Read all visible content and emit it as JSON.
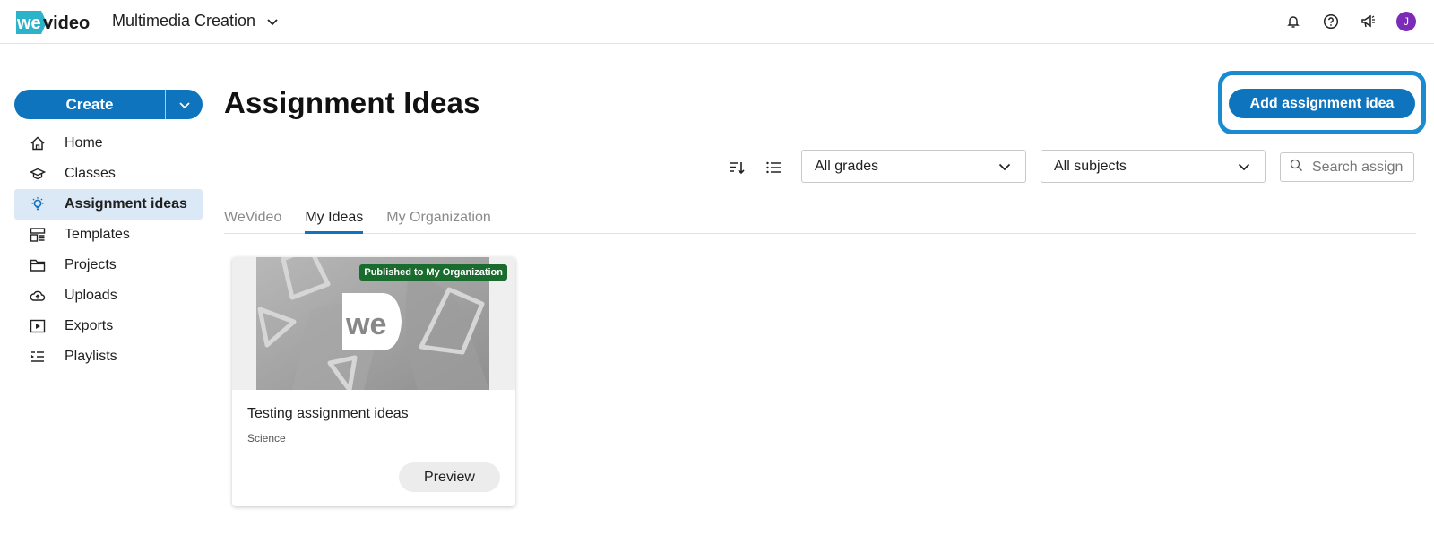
{
  "header": {
    "logo_text": "wevideo",
    "workspace": "Multimedia Creation",
    "icons": [
      "bell-icon",
      "help-icon",
      "megaphone-icon"
    ],
    "avatar_initial": "J",
    "avatar_color": "#7b2bb8"
  },
  "sidebar": {
    "create_label": "Create",
    "items": [
      {
        "label": "Home",
        "icon": "home-icon"
      },
      {
        "label": "Classes",
        "icon": "classes-icon"
      },
      {
        "label": "Assignment ideas",
        "icon": "lightbulb-icon",
        "active": true
      },
      {
        "label": "Templates",
        "icon": "templates-icon"
      },
      {
        "label": "Projects",
        "icon": "folder-icon"
      },
      {
        "label": "Uploads",
        "icon": "cloud-upload-icon"
      },
      {
        "label": "Exports",
        "icon": "export-play-icon"
      },
      {
        "label": "Playlists",
        "icon": "playlist-icon"
      }
    ]
  },
  "main": {
    "title": "Assignment Ideas",
    "add_button": "Add assignment idea",
    "filters": {
      "grades": "All grades",
      "subjects": "All subjects",
      "search_placeholder": "Search assign"
    },
    "tabs": [
      {
        "label": "WeVideo",
        "active": false
      },
      {
        "label": "My Ideas",
        "active": true
      },
      {
        "label": "My Organization",
        "active": false
      }
    ],
    "cards": [
      {
        "badge": "Published to My Organization",
        "title": "Testing assignment ideas",
        "subject": "Science",
        "button": "Preview"
      }
    ]
  },
  "colors": {
    "accent": "#0d74bd",
    "active_nav_bg": "#dbe9f7",
    "badge_bg": "#1a6b2e",
    "focus_ring": "#1a8bd0"
  }
}
